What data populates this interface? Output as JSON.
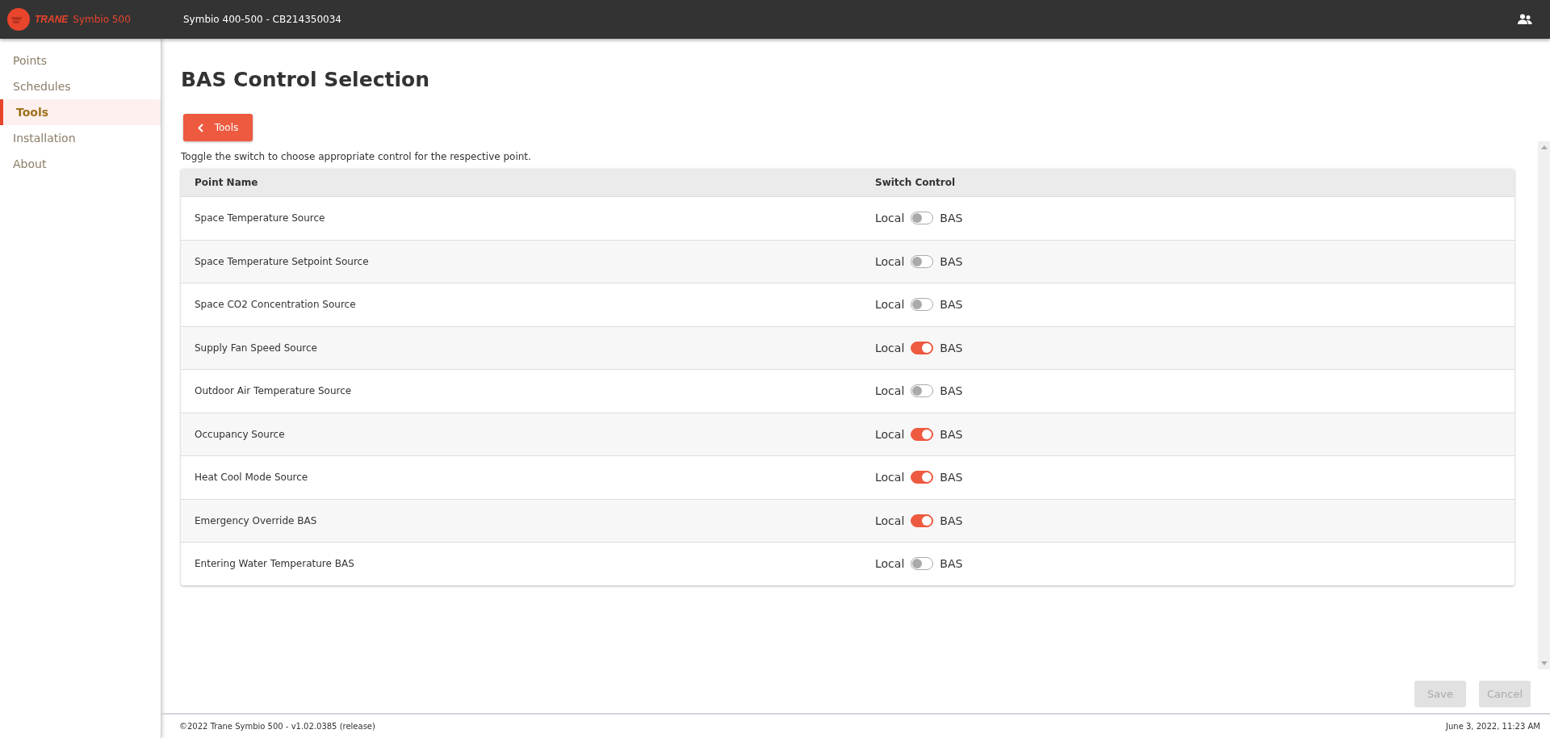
{
  "header": {
    "brand": "TRANE",
    "product": "Symbio 500",
    "device": "Symbio 400-500 - CB214350034"
  },
  "sidebar": {
    "items": [
      {
        "label": "Points",
        "selected": false
      },
      {
        "label": "Schedules",
        "selected": false
      },
      {
        "label": "Tools",
        "selected": true
      },
      {
        "label": "Installation",
        "selected": false
      },
      {
        "label": "About",
        "selected": false
      }
    ]
  },
  "page": {
    "title": "BAS Control Selection",
    "back_button": "Tools",
    "description": "Toggle the switch to choose appropriate control for the respective point."
  },
  "table": {
    "columns": [
      "Point Name",
      "Switch Control"
    ],
    "rows": [
      {
        "name": "Space Temperature Source",
        "left": "Local",
        "right": "BAS",
        "on": false
      },
      {
        "name": "Space Temperature Setpoint Source",
        "left": "Local",
        "right": "BAS",
        "on": false
      },
      {
        "name": "Space CO2 Concentration Source",
        "left": "Local",
        "right": "BAS",
        "on": false
      },
      {
        "name": "Supply Fan Speed Source",
        "left": "Local",
        "right": "BAS",
        "on": true
      },
      {
        "name": "Outdoor Air Temperature Source",
        "left": "Local",
        "right": "BAS",
        "on": false
      },
      {
        "name": "Occupancy Source",
        "left": "Local",
        "right": "BAS",
        "on": true
      },
      {
        "name": "Heat Cool Mode Source",
        "left": "Local",
        "right": "BAS",
        "on": true
      },
      {
        "name": "Emergency Override BAS",
        "left": "Local",
        "right": "BAS",
        "on": true
      },
      {
        "name": "Entering Water Temperature BAS",
        "left": "Local",
        "right": "BAS",
        "on": false
      }
    ]
  },
  "actions": [
    {
      "label": "Save",
      "disabled": true
    },
    {
      "label": "Cancel",
      "disabled": true
    }
  ],
  "footer": {
    "copyright": "©2022 Trane Symbio 500 - v1.02.0385 (release)",
    "timestamp": "June 3, 2022, 11:23 AM"
  }
}
